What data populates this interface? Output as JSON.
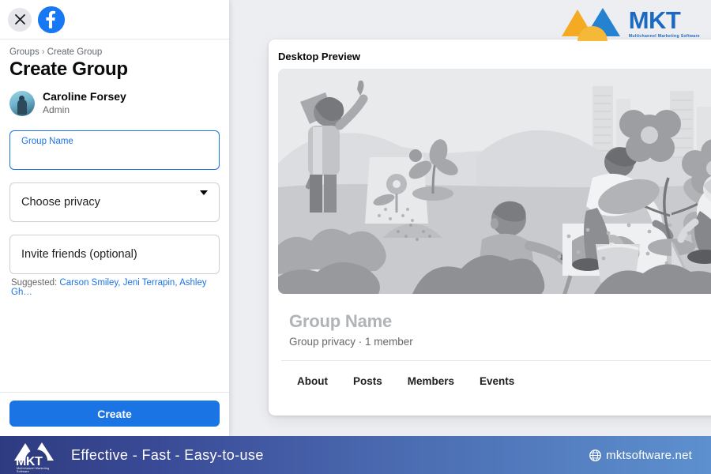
{
  "watermark": {
    "brand": "MKT",
    "tagline": "Multichannel Marketing Software",
    "logo_icon": "mkt-mountains-icon",
    "orange": "#f5a81c",
    "blue": "#1565c0"
  },
  "sidebar": {
    "close_icon": "close-icon",
    "facebook_icon": "facebook-logo-icon",
    "breadcrumb": {
      "parent": "Groups",
      "separator": "›",
      "current": "Create Group"
    },
    "page_title": "Create Group",
    "user": {
      "name": "Caroline Forsey",
      "role": "Admin",
      "avatar_icon": "user-avatar"
    },
    "fields": {
      "group_name": {
        "label": "Group Name",
        "value": "",
        "focused": true
      },
      "privacy": {
        "label": "Choose privacy",
        "value": "",
        "caret_icon": "chevron-down-icon"
      },
      "invite": {
        "label": "Invite friends (optional)",
        "value": ""
      }
    },
    "suggested": {
      "prefix": "Suggested:",
      "names": "Carson Smiley, Jeni Terrapin, Ashley Gh…"
    },
    "create_label": "Create",
    "accent": "#1b74e4"
  },
  "preview": {
    "title": "Desktop Preview",
    "cover_icon": "community-gardening-illustration",
    "group_name": "Group Name",
    "group_sub": "Group privacy · 1 member",
    "tabs": [
      {
        "label": "About"
      },
      {
        "label": "Posts"
      },
      {
        "label": "Members"
      },
      {
        "label": "Events"
      }
    ]
  },
  "banner": {
    "brand": "MKT",
    "brand_sub": "Multichannel Marketing Software",
    "logo_icon": "mkt-mountains-icon",
    "tagline": "Effective - Fast - Easy-to-use",
    "globe_icon": "globe-icon",
    "url": "mktsoftware.net",
    "gradient_from": "#2e3b80",
    "gradient_to": "#5d90cf"
  }
}
